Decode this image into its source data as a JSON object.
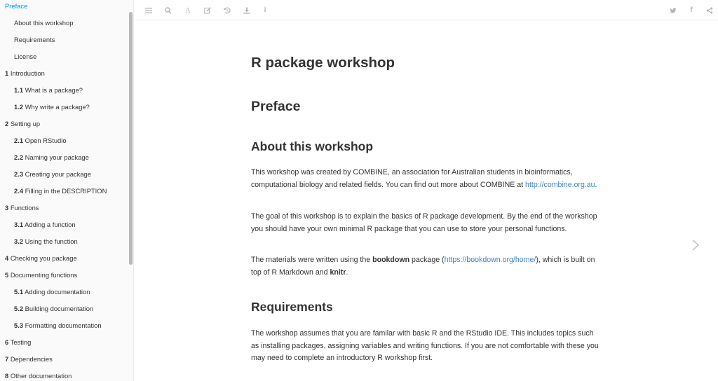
{
  "toc": {
    "items": [
      {
        "num": "",
        "label": "Preface",
        "level": 0,
        "active": true
      },
      {
        "num": "",
        "label": "About this workshop",
        "level": 1
      },
      {
        "num": "",
        "label": "Requirements",
        "level": 1
      },
      {
        "num": "",
        "label": "License",
        "level": 1
      },
      {
        "num": "1",
        "label": "Introduction",
        "level": 0
      },
      {
        "num": "1.1",
        "label": "What is a package?",
        "level": 1
      },
      {
        "num": "1.2",
        "label": "Why write a package?",
        "level": 1
      },
      {
        "num": "2",
        "label": "Setting up",
        "level": 0
      },
      {
        "num": "2.1",
        "label": "Open RStudio",
        "level": 1
      },
      {
        "num": "2.2",
        "label": "Naming your package",
        "level": 1
      },
      {
        "num": "2.3",
        "label": "Creating your package",
        "level": 1
      },
      {
        "num": "2.4",
        "label": "Filling in the DESCRIPTION",
        "level": 1
      },
      {
        "num": "3",
        "label": "Functions",
        "level": 0
      },
      {
        "num": "3.1",
        "label": "Adding a function",
        "level": 1
      },
      {
        "num": "3.2",
        "label": "Using the function",
        "level": 1
      },
      {
        "num": "4",
        "label": "Checking you package",
        "level": 0
      },
      {
        "num": "5",
        "label": "Documenting functions",
        "level": 0
      },
      {
        "num": "5.1",
        "label": "Adding documentation",
        "level": 1
      },
      {
        "num": "5.2",
        "label": "Building documentation",
        "level": 1
      },
      {
        "num": "5.3",
        "label": "Formatting documentation",
        "level": 1
      },
      {
        "num": "6",
        "label": "Testing",
        "level": 0
      },
      {
        "num": "7",
        "label": "Dependencies",
        "level": 0
      },
      {
        "num": "8",
        "label": "Other documentation",
        "level": 0
      }
    ]
  },
  "toolbar": {
    "left_icons": [
      "toggle-sidebar-icon",
      "search-icon",
      "font-settings-icon",
      "edit-icon",
      "history-icon",
      "download-icon",
      "info-icon"
    ],
    "right_icons": [
      "twitter-icon",
      "facebook-icon",
      "share-icon"
    ],
    "font_glyph": "A",
    "info_glyph": "i",
    "facebook_glyph": "f"
  },
  "content": {
    "title": "R package workshop",
    "preface_heading": "Preface",
    "about_heading": "About this workshop",
    "about_p1_text": "This workshop was created by COMBINE, an association for Australian students in bioinformatics, computational biology and related fields. You can find out more about COMBINE at",
    "about_p1_link": "http://combine.org.au",
    "about_p1_end": ".",
    "about_p2": "The goal of this workshop is to explain the basics of R package development. By the end of the workshop you should have your own minimal R package that you can use to store your personal functions.",
    "about_p3_a": "The materials were written using the",
    "about_p3_bold1": "bookdown",
    "about_p3_b": "package (",
    "about_p3_link": "https://bookdown.org/home/",
    "about_p3_c": "), which is built on top of R Markdown and",
    "about_p3_bold2": "knitr",
    "about_p3_end": ".",
    "req_heading": "Requirements",
    "req_p1": "The workshop assumes that you are familar with basic R and the RStudio IDE. This includes topics such as installing packages, assigning variables and writing functions. If you are not comfortable with these you may need to complete an introductory R workshop first."
  },
  "colors": {
    "accent": "#008cff",
    "link": "#4183c4",
    "text": "#333333",
    "icon": "#b5b5b5",
    "sidebar_bg": "#fafafa"
  }
}
